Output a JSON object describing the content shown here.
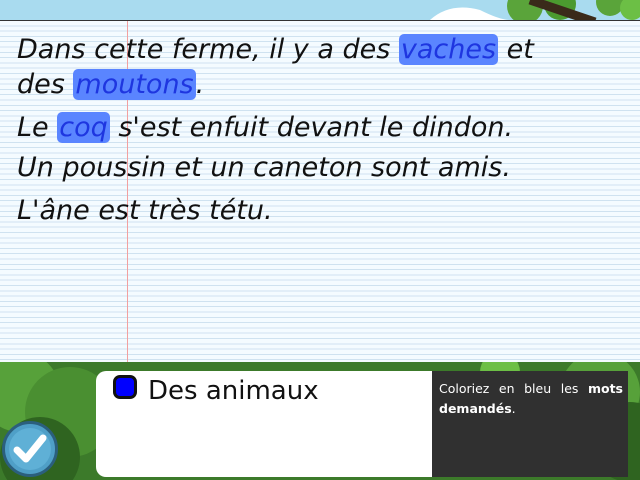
{
  "sentences": {
    "s1a_pre": "Dans cette ferme, il y a des ",
    "s1a_word": "vaches",
    "s1a_post": " et",
    "s1b_pre": "des ",
    "s1b_word": "moutons",
    "s1b_post": ".",
    "s2_pre": "Le ",
    "s2_word": "coq",
    "s2_post": " s'est enfuit devant le dindon.",
    "s3": "Un poussin et un caneton sont amis.",
    "s4": "L'âne est très tétu."
  },
  "task": {
    "color": "#0000ff",
    "label": "Des animaux"
  },
  "instruction": {
    "part1": "Coloriez en bleu les ",
    "bold": "mots demandés",
    "part2": "."
  },
  "colors": {
    "highlight": "#5a85ff",
    "paper": "#f4fbff",
    "instruction_bg": "#303030"
  },
  "icons": {
    "validate": "checkmark-icon",
    "color_swatch": "color-swatch"
  }
}
